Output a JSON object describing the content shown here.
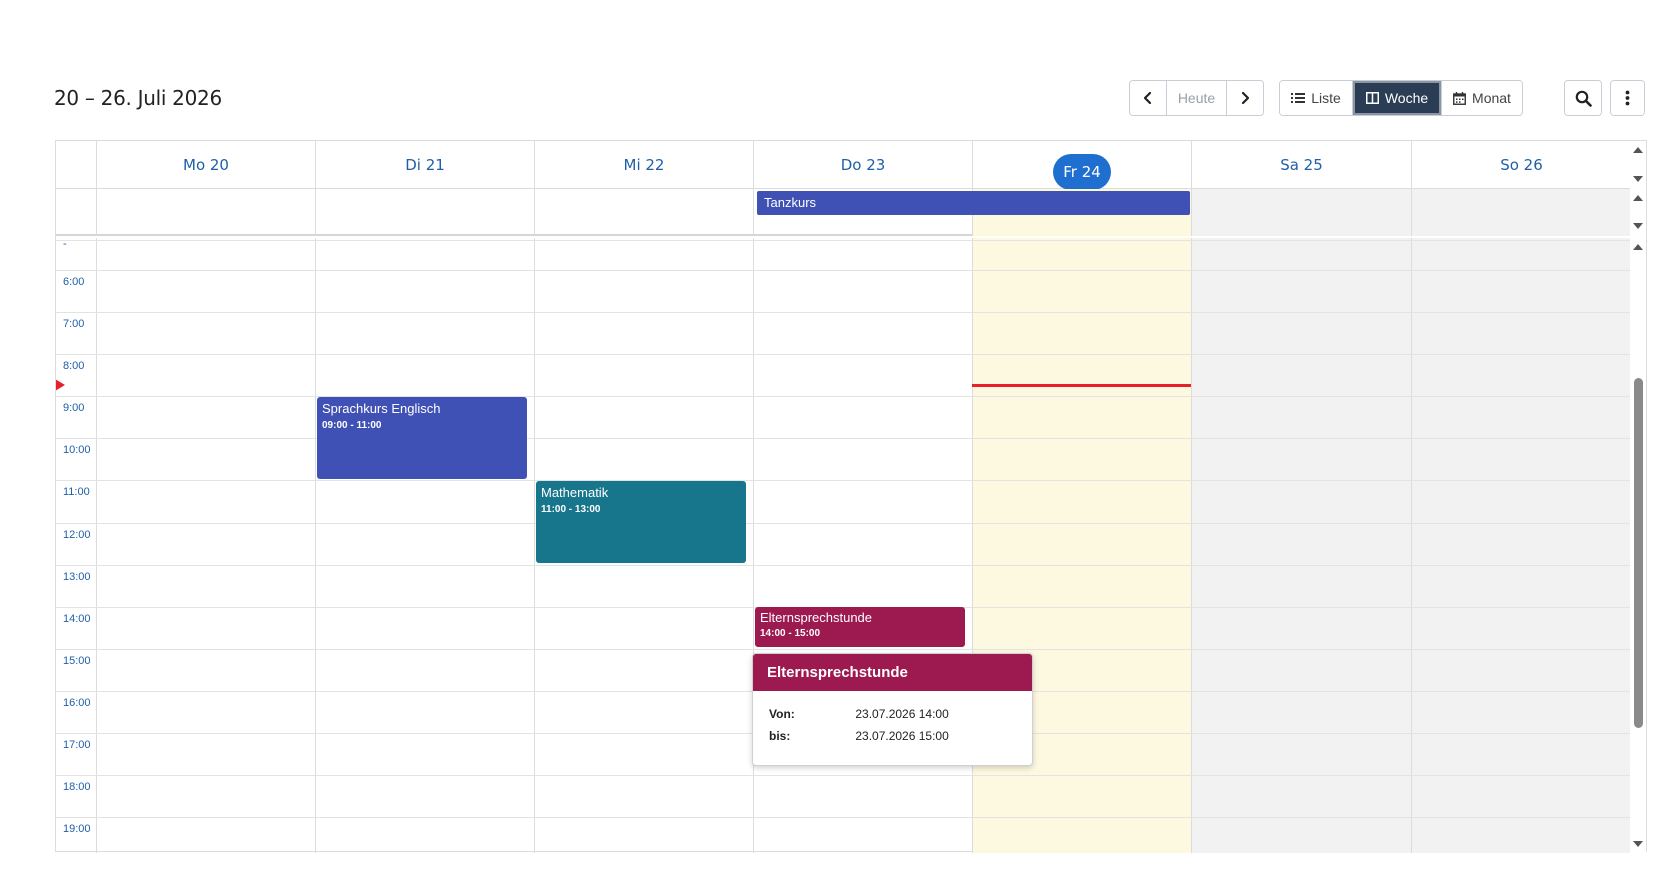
{
  "header": {
    "title": "20 – 26. Juli 2026"
  },
  "toolbar": {
    "prev_icon": "chevron-left-icon",
    "today_label": "Heute",
    "next_icon": "chevron-right-icon",
    "view_list_label": "Liste",
    "view_week_label": "Woche",
    "view_month_label": "Monat",
    "search_icon": "search-icon",
    "more_icon": "more-vertical-icon"
  },
  "days": [
    {
      "label": "Mo 20"
    },
    {
      "label": "Di 21"
    },
    {
      "label": "Mi 22"
    },
    {
      "label": "Do 23"
    },
    {
      "label": "Fr 24"
    },
    {
      "label": "Sa 25"
    },
    {
      "label": "So 26"
    }
  ],
  "allday_events": [
    {
      "title": "Tanzkurs"
    }
  ],
  "hours": [
    "6:00",
    "7:00",
    "8:00",
    "9:00",
    "10:00",
    "11:00",
    "12:00",
    "13:00",
    "14:00",
    "15:00",
    "16:00",
    "17:00",
    "18:00",
    "19:00"
  ],
  "events": [
    {
      "title": "Sprachkurs Englisch",
      "time": "09:00 - 11:00",
      "color": "#3f51b5"
    },
    {
      "title": "Mathematik",
      "time": "11:00 - 13:00",
      "color": "#17758c"
    },
    {
      "title": "Elternsprechstunde",
      "time": "14:00 - 15:00",
      "color": "#9c1a50"
    }
  ],
  "popover": {
    "title": "Elternsprechstunde",
    "from_label": "Von:",
    "from_value": "23.07.2026 14:00",
    "to_label": "bis:",
    "to_value": "23.07.2026 15:00"
  },
  "colors": {
    "accent": "#1f6fd0",
    "today_bg": "#fdf8e0",
    "weekend_bg": "#f2f2f2",
    "now_line": "#e8202a"
  }
}
